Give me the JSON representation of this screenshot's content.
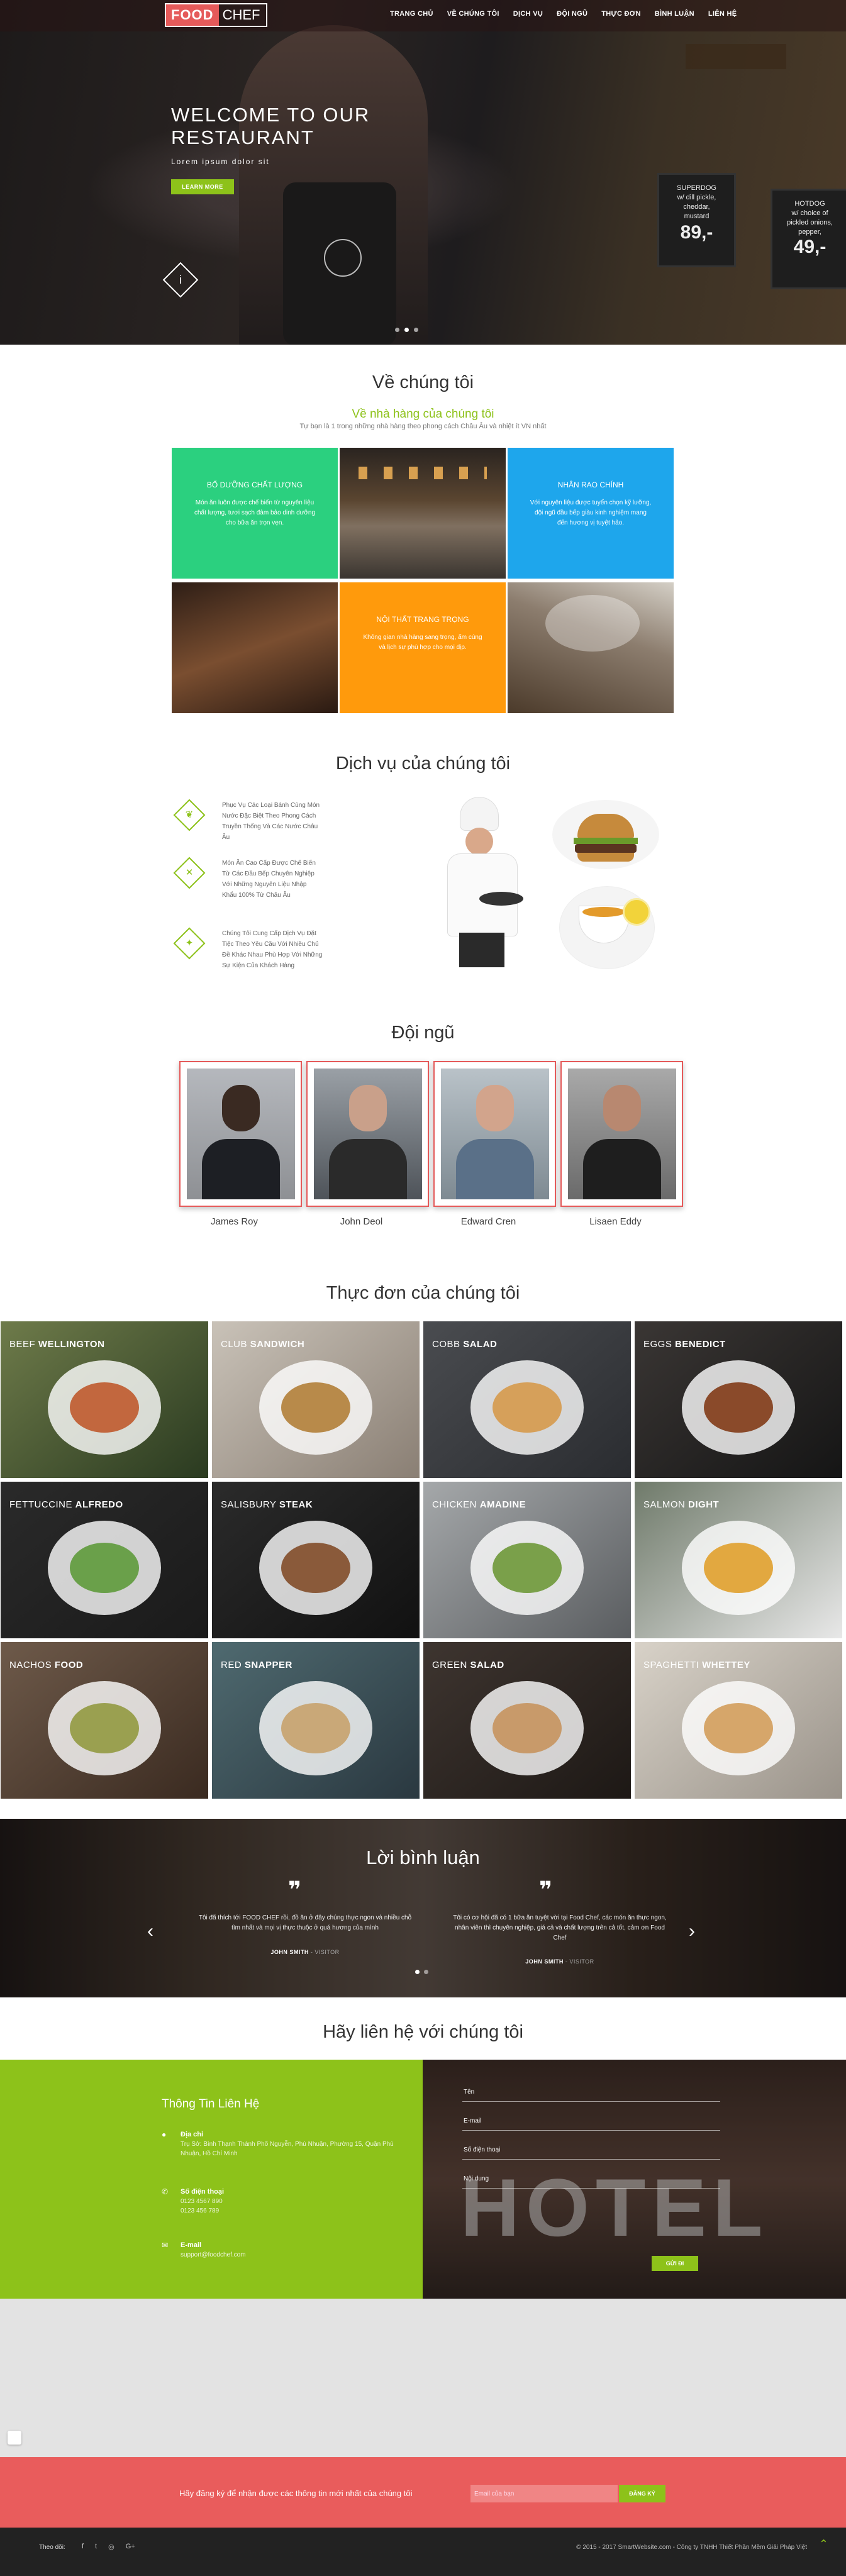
{
  "nav": {
    "logo_food": "FOOD",
    "logo_chef": "CHEF",
    "items": [
      "TRANG CHỦ",
      "VỀ CHÚNG TÔI",
      "DỊCH VỤ",
      "ĐỘI NGŨ",
      "THỰC ĐƠN",
      "BÌNH LUẬN",
      "LIÊN HỆ"
    ]
  },
  "hero": {
    "title": "WELCOME TO OUR RESTAURANT",
    "subtitle": "Lorem ipsum dolor sit",
    "button": "LEARN MORE",
    "info_icon": "info-icon",
    "board1": [
      "SUPERDOG",
      "w/ dill pickle,",
      "cheddar,",
      "mustard",
      "89,-"
    ],
    "board2": [
      "HOTDOG",
      "w/ choice of",
      "pickled onions,",
      "pepper,",
      "49,-"
    ]
  },
  "about": {
    "title": "Về chúng tôi",
    "subtitle": "Về nhà hàng của chúng tôi",
    "desc": "Tự bạn là 1 trong những nhà hàng theo phong cách Châu Âu và nhiệt ít VN nhất",
    "tiles": [
      {
        "title": "BỔ DƯỠNG CHẤT LƯỢNG",
        "text": "Món ăn luôn được chế biến từ nguyên liệu chất lượng, tươi sạch đảm bảo dinh dưỡng cho bữa ăn trọn vẹn."
      },
      {
        "title": "NHÂN RAO CHÍNH",
        "text": "Với nguyên liệu được tuyển chọn kỹ lưỡng, đội ngũ đầu bếp giàu kinh nghiệm mang đến hương vị tuyệt hảo."
      },
      {
        "title": "NỘI THẤT TRANG TRỌNG",
        "text": "Không gian nhà hàng sang trọng, ấm cúng và lịch sự phù hợp cho mọi dịp."
      }
    ]
  },
  "services": {
    "title": "Dịch vụ của chúng tôi",
    "items": [
      {
        "icon": "leaf-icon",
        "text": "Phục Vụ Các Loại Bánh Cùng Món Nước Đặc Biệt Theo Phong Cách Truyền Thống Và Các Nước Châu Âu"
      },
      {
        "icon": "utensils-icon",
        "text": "Món Ăn Cao Cấp Được Chế Biến Từ Các Đầu Bếp Chuyên Nghiệp Với Những Nguyên Liệu Nhập Khẩu 100% Từ Châu Âu"
      },
      {
        "icon": "food-icon",
        "text": "Chúng Tôi Cung Cấp Dịch Vụ Đặt Tiệc Theo Yêu Cầu Với Nhiều Chủ Đề Khác Nhau Phù Hợp Với Những Sự Kiện Của Khách Hàng"
      }
    ]
  },
  "team": {
    "title": "Đội ngũ",
    "members": [
      "James Roy",
      "John Deol",
      "Edward Cren",
      "Lisaen Eddy"
    ]
  },
  "menu": {
    "title": "Thực đơn của chúng tôi",
    "items": [
      {
        "light": "BEEF",
        "bold": "WELLINGTON"
      },
      {
        "light": "CLUB",
        "bold": "SANDWICH"
      },
      {
        "light": "COBB",
        "bold": "SALAD"
      },
      {
        "light": "EGGS",
        "bold": "BENEDICT"
      },
      {
        "light": "FETTUCCINE",
        "bold": "ALFREDO"
      },
      {
        "light": "SALISBURY",
        "bold": "STEAK"
      },
      {
        "light": "CHICKEN",
        "bold": "AMADINE"
      },
      {
        "light": "SALMON",
        "bold": "DIGHT"
      },
      {
        "light": "NACHOS",
        "bold": "FOOD"
      },
      {
        "light": "RED",
        "bold": "SNAPPER"
      },
      {
        "light": "GREEN",
        "bold": "SALAD"
      },
      {
        "light": "SPAGHETTI",
        "bold": "WHETTEY"
      }
    ]
  },
  "testimonials": {
    "title": "Lời bình luận",
    "items": [
      {
        "quote": "Tôi đã thích tới FOOD CHEF rồi, đồ ăn ở đây chúng thực ngon và nhiều chỗ tìm nhất và mọi vị thực thuộc ở quá hương của mình",
        "name": "JOHN SMITH",
        "role": "- VISITOR"
      },
      {
        "quote": "Tôi có cơ hội đã có 1 bữa ăn tuyệt vời tại Food Chef, các món ăn thực ngon, nhân viên thì chuyên nghiệp, giá cả và chất lượng trên cả tốt, cảm ơn Food Chef",
        "name": "JOHN SMITH",
        "role": "- VISITOR"
      }
    ]
  },
  "contact": {
    "title": "Hãy liên hệ với chúng tôi",
    "info_title": "Thông Tin Liên Hệ",
    "address_label": "Địa chỉ",
    "address_value": "Trụ Sở: Bình Thạnh Thành Phố Nguyễn, Phú Nhuận, Phường 15, Quận Phú Nhuận, Hồ Chí Minh",
    "phone_label": "Số điện thoại",
    "phone_value": "0123 4567 890\n0123 456 789",
    "email_label": "E-mail",
    "email_value": "support@foodchef.com",
    "name_placeholder": "Tên",
    "email_placeholder": "E-mail",
    "phone_placeholder": "Số điện thoại",
    "message_placeholder": "Nội dung",
    "send_button": "GỬI ĐI",
    "bg_text": "HOTEL"
  },
  "newsletter": {
    "text": "Hãy đăng ký để nhận được các thông tin mới nhất của chúng tôi",
    "placeholder": "Email của bạn",
    "button": "ĐĂNG KÝ"
  },
  "footer": {
    "follow": "Theo dõi:",
    "social": [
      "f",
      "t",
      "◎",
      "G+"
    ],
    "copyright": "© 2015 - 2017 SmartWebsite.com - Công ty TNHH Thiết Phần Mềm Giải Pháp Việt"
  },
  "colors": {
    "green": "#8dc21a",
    "red": "#e95c5c",
    "blue": "#1ea6ec",
    "orange": "#ff9a0c",
    "teal": "#2bd07f"
  }
}
